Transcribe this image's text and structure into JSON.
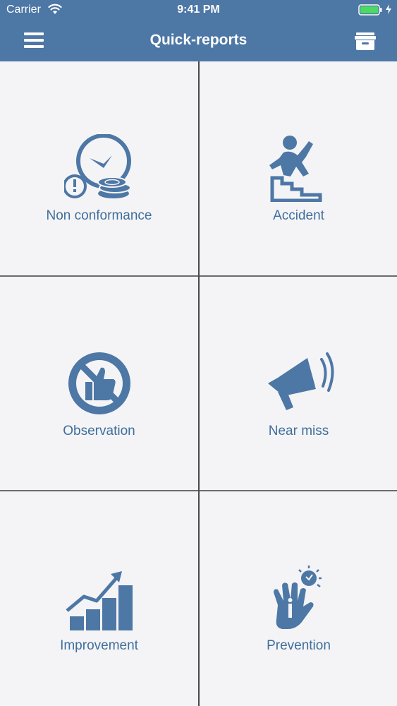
{
  "status_bar": {
    "carrier": "Carrier",
    "time": "9:41 PM"
  },
  "nav": {
    "title": "Quick-reports",
    "menu_icon": "hamburger-menu-icon",
    "archive_icon": "archive-box-icon"
  },
  "colors": {
    "header": "#4d77a5",
    "accent": "#3f6e9c",
    "background": "#f4f4f6",
    "battery": "#4cd964"
  },
  "tiles": [
    {
      "label": "Non conformance",
      "icon": "clock-coins-warning-icon"
    },
    {
      "label": "Accident",
      "icon": "person-falling-stairs-icon"
    },
    {
      "label": "Observation",
      "icon": "thumbs-up-prohibited-icon"
    },
    {
      "label": "Near miss",
      "icon": "megaphone-icon"
    },
    {
      "label": "Improvement",
      "icon": "growth-chart-icon"
    },
    {
      "label": "Prevention",
      "icon": "hand-lightbulb-icon"
    }
  ]
}
